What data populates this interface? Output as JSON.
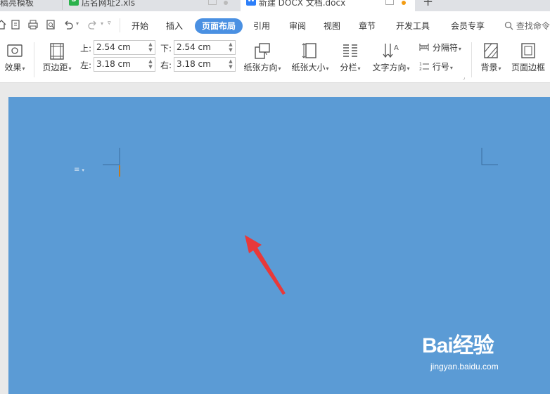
{
  "tabs": [
    {
      "label": "稿亮模板",
      "icon": "template-icon"
    },
    {
      "label": "店名网址2.xls",
      "icon": "spreadsheet-icon",
      "color": "#2bb24c"
    },
    {
      "label": "新建 DOCX 文档.docx",
      "icon": "writer-icon",
      "color": "#2d7ff9",
      "active": true
    }
  ],
  "menu": {
    "items": [
      "开始",
      "插入",
      "页面布局",
      "引用",
      "审阅",
      "视图",
      "章节",
      "开发工具",
      "会员专享"
    ],
    "active": "页面布局",
    "search_label": "查找命令"
  },
  "ribbon": {
    "effects_label": "效果",
    "margins_label": "页边距",
    "top_label": "上:",
    "top_value": "2.54 cm",
    "bottom_label": "下:",
    "bottom_value": "2.54 cm",
    "left_label": "左:",
    "left_value": "3.18 cm",
    "right_label": "右:",
    "right_value": "3.18 cm",
    "orientation_label": "纸张方向",
    "size_label": "纸张大小",
    "columns_label": "分栏",
    "text_direction_label": "文字方向",
    "separator_label": "分隔符",
    "line_number_label": "行号",
    "background_label": "背景",
    "page_border_label": "页面边框"
  },
  "document": {
    "page_color": "#5b9bd5",
    "annotation_color": "#e8393a"
  },
  "watermark": {
    "brand": "Bai经验",
    "url": "jingyan.baidu.com"
  }
}
